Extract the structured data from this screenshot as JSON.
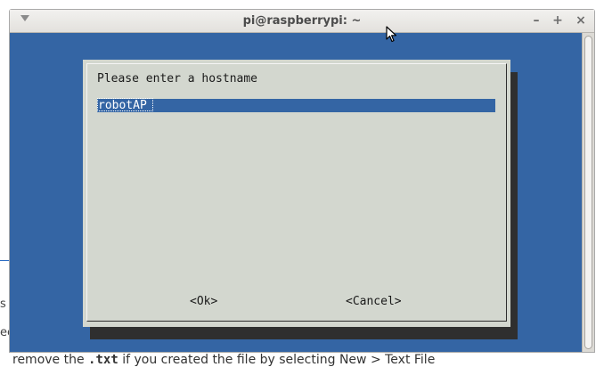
{
  "background": {
    "fragment_1": "s S",
    "fragment_2": "ec",
    "bottom_text_prefix": "remove the",
    "bottom_text_code": ".txt",
    "bottom_text_suffix": "if you created the file by selecting New > Text File"
  },
  "window": {
    "title": "pi@raspberrypi: ~",
    "menu_icon": "chevron-down-icon",
    "minimize_glyph": "–",
    "maximize_glyph": "+",
    "close_glyph": "×"
  },
  "dialog": {
    "prompt": "Please enter a hostname",
    "input_value": "robotAP",
    "ok_label": "<Ok>",
    "cancel_label": "<Cancel>"
  },
  "colors": {
    "terminal_bg": "#3465a4",
    "dialog_bg": "#d3d7cf",
    "shadow": "#2f2f2f"
  }
}
